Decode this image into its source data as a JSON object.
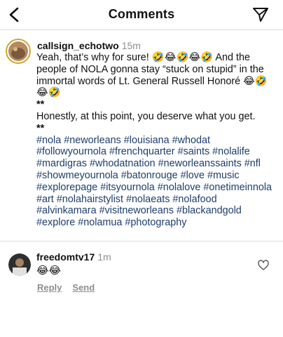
{
  "header": {
    "title": "Comments",
    "back_icon": "chevron-left-icon",
    "send_icon": "paper-plane-icon"
  },
  "comments": [
    {
      "username": "callsign_echotwo",
      "time": "15m",
      "line1": "Yeah, that’s why for sure! 🤣😂🤣😂🤣 And the people of NOLA gonna stay “stuck on stupid” in the immortal words of Lt. General Russell Honoré 😂🤣😂🤣",
      "mark1": "**",
      "line2": "Honestly, at this point, you deserve what you get.",
      "mark2": "**",
      "hashtags": "#nola #neworleans #louisiana #whodat #followyournola #frenchquarter #saints #nolalife #mardigras #whodatnation #neworleanssaints #nfl #showmeyournola #batonrouge #love #music #explorepage #itsyournola #nolalove #onetimeinnola #art #nolahairstylist #nolaeats #nolafood #alvinkamara #visitneworleans #blackandgold #explore #nolamua #photography"
    },
    {
      "username": "freedomtv17",
      "time": "1m",
      "text": "😂😂",
      "reply_label": "Reply",
      "send_label": "Send"
    }
  ],
  "colors": {
    "hashtag": "#1d3e6e",
    "muted": "#8e8e8e",
    "divider": "#dbdbdb"
  }
}
